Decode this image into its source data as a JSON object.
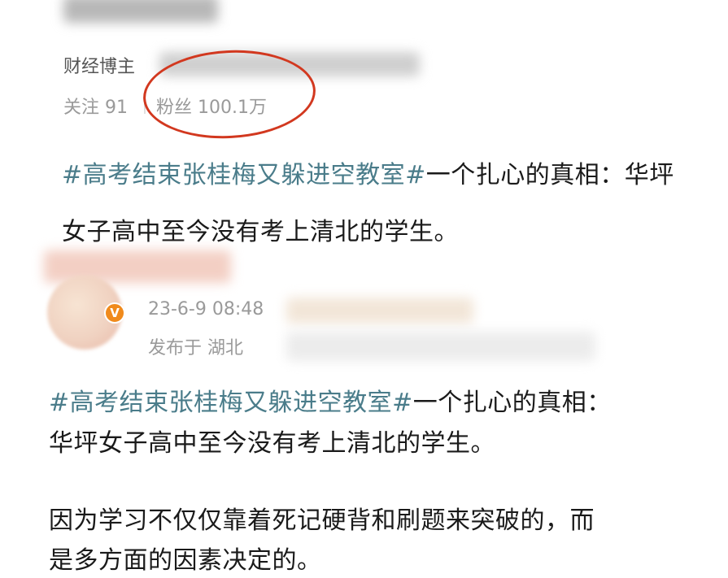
{
  "profile": {
    "role": "财经博主",
    "following": "关注 91",
    "followers": "粉丝 100.1万"
  },
  "post1": {
    "hashtag": "#高考结束张桂梅又躲进空教室#",
    "line1_rest": "一个扎心的真相：华坪",
    "line2": "女子高中至今没有考上清北的学生。"
  },
  "post2": {
    "timestamp": "23-6-9 08:48",
    "location": "发布于 湖北",
    "verified_badge": "V",
    "hashtag": "#高考结束张桂梅又躲进空教室#",
    "line1_rest": "一个扎心的真相：",
    "line2": "华坪女子高中至今没有考上清北的学生。",
    "para2_line1": "因为学习不仅仅靠着死记硬背和刷题来突破的，而",
    "para2_line2": "是多方面的因素决定的。"
  },
  "colors": {
    "hashtag": "#4a7c8a",
    "annotation_circle": "#d2381f",
    "verified_badge": "#f08a1c"
  }
}
